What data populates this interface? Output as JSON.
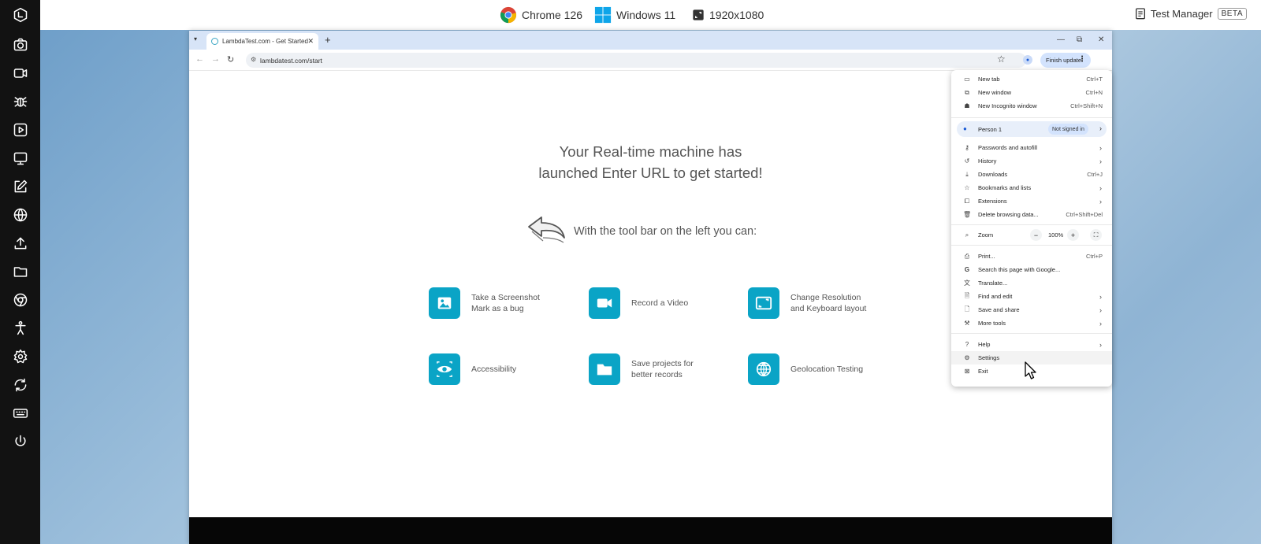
{
  "topbar": {
    "browser_label": "Chrome 126",
    "os_label": "Windows 11",
    "resolution_label": "1920x1080",
    "test_manager_label": "Test Manager",
    "beta_badge": "BETA"
  },
  "sidebar": {
    "icons": [
      "logo-icon",
      "camera-icon",
      "video-icon",
      "bug-icon",
      "play-icon",
      "desktop-icon",
      "edit-icon",
      "globe-icon",
      "upload-icon",
      "folder-icon",
      "chrome-icon",
      "accessibility-icon",
      "gear-icon",
      "switch-icon",
      "keyboard-icon",
      "power-icon"
    ]
  },
  "browser": {
    "tab_title": "LambdaTest.com - Get Started",
    "url": "lambdatest.com/start",
    "finish_update_label": "Finish update"
  },
  "page": {
    "headline_line1": "Your Real-time machine has",
    "headline_line2": "launched Enter URL to get started!",
    "toolbar_text": "With the tool bar on the left you can:",
    "features": [
      {
        "line1": "Take a Screenshot",
        "line2": "Mark as a bug",
        "icon": "image-icon"
      },
      {
        "line1": "Record a Video",
        "line2": "",
        "icon": "video-icon"
      },
      {
        "line1": "Change Resolution",
        "line2": "and Keyboard layout",
        "icon": "resolution-icon"
      },
      {
        "line1": "Accessibility",
        "line2": "",
        "icon": "eye-icon"
      },
      {
        "line1": "Save projects for",
        "line2": "better records",
        "icon": "folder-icon"
      },
      {
        "line1": "Geolocation Testing",
        "line2": "",
        "icon": "globe-icon"
      }
    ]
  },
  "menu": {
    "new_tab": {
      "label": "New tab",
      "shortcut": "Ctrl+T"
    },
    "new_window": {
      "label": "New window",
      "shortcut": "Ctrl+N"
    },
    "new_incognito": {
      "label": "New Incognito window",
      "shortcut": "Ctrl+Shift+N"
    },
    "person": {
      "label": "Person 1",
      "badge": "Not signed in"
    },
    "passwords": {
      "label": "Passwords and autofill"
    },
    "history": {
      "label": "History"
    },
    "downloads": {
      "label": "Downloads",
      "shortcut": "Ctrl+J"
    },
    "bookmarks": {
      "label": "Bookmarks and lists"
    },
    "extensions": {
      "label": "Extensions"
    },
    "delete_data": {
      "label": "Delete browsing data...",
      "shortcut": "Ctrl+Shift+Del"
    },
    "zoom": {
      "label": "Zoom",
      "value": "100%",
      "minus": "−",
      "plus": "+"
    },
    "print": {
      "label": "Print...",
      "shortcut": "Ctrl+P"
    },
    "search_page": {
      "label": "Search this page with Google..."
    },
    "translate": {
      "label": "Translate..."
    },
    "find_edit": {
      "label": "Find and edit"
    },
    "save_share": {
      "label": "Save and share"
    },
    "more_tools": {
      "label": "More tools"
    },
    "help": {
      "label": "Help"
    },
    "settings": {
      "label": "Settings"
    },
    "exit": {
      "label": "Exit"
    }
  }
}
